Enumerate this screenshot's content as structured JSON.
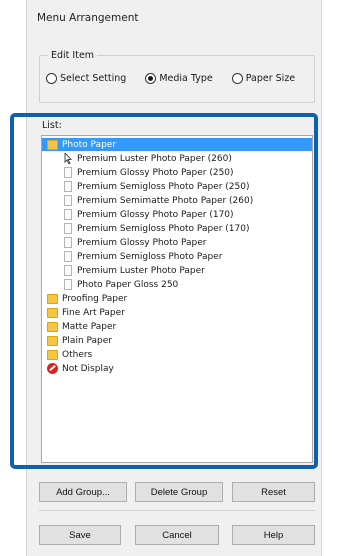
{
  "window": {
    "title": "Menu Arrangement"
  },
  "edit_item": {
    "label": "Edit Item",
    "options": [
      {
        "label": "Select Setting",
        "checked": false
      },
      {
        "label": "Media Type",
        "checked": true
      },
      {
        "label": "Paper Size",
        "checked": false
      }
    ]
  },
  "list": {
    "label": "List:",
    "items": [
      {
        "label": "Photo Paper",
        "icon": "folder-icon",
        "level": 0,
        "selected": true
      },
      {
        "label": "Premium Luster Photo Paper (260)",
        "icon": "cursor-icon",
        "level": 1
      },
      {
        "label": "Premium Glossy Photo Paper (250)",
        "icon": "document-icon",
        "level": 1
      },
      {
        "label": "Premium Semigloss Photo Paper (250)",
        "icon": "document-icon",
        "level": 1
      },
      {
        "label": "Premium Semimatte Photo Paper (260)",
        "icon": "document-icon",
        "level": 1
      },
      {
        "label": "Premium Glossy Photo Paper (170)",
        "icon": "document-icon",
        "level": 1
      },
      {
        "label": "Premium Semigloss Photo Paper (170)",
        "icon": "document-icon",
        "level": 1
      },
      {
        "label": "Premium Glossy Photo Paper",
        "icon": "document-icon",
        "level": 1
      },
      {
        "label": "Premium Semigloss Photo Paper",
        "icon": "document-icon",
        "level": 1
      },
      {
        "label": "Premium Luster Photo Paper",
        "icon": "document-icon",
        "level": 1
      },
      {
        "label": "Photo Paper Gloss 250",
        "icon": "document-icon",
        "level": 1
      },
      {
        "label": "Proofing Paper",
        "icon": "folder-icon",
        "level": 0
      },
      {
        "label": "Fine Art Paper",
        "icon": "folder-icon",
        "level": 0
      },
      {
        "label": "Matte Paper",
        "icon": "folder-icon",
        "level": 0
      },
      {
        "label": "Plain Paper",
        "icon": "folder-icon",
        "level": 0
      },
      {
        "label": "Others",
        "icon": "folder-icon",
        "level": 0
      },
      {
        "label": "Not Display",
        "icon": "not-display-icon",
        "level": 0
      }
    ]
  },
  "buttons": {
    "add_group": "Add Group...",
    "delete_group": "Delete Group",
    "reset": "Reset",
    "save": "Save",
    "cancel": "Cancel",
    "help": "Help"
  },
  "colors": {
    "highlight_frame": "#1160b0",
    "selection": "#3399ff",
    "folder": "#f5c542",
    "not_display": "#e02020"
  }
}
